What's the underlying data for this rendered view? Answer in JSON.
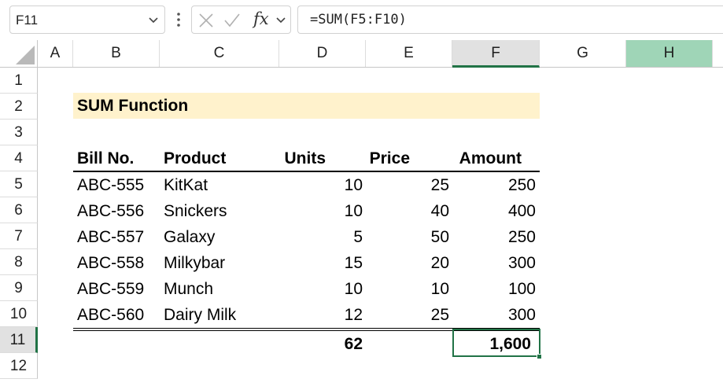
{
  "formula_bar": {
    "name_box": "F11",
    "formula": "=SUM(F5:F10)",
    "fx_label": "fx",
    "icons": [
      "chevron-down-icon",
      "more-vertical-icon",
      "cancel-x-icon",
      "enter-check-icon",
      "insert-function-icon"
    ]
  },
  "columns": [
    "A",
    "B",
    "C",
    "D",
    "E",
    "F",
    "G",
    "H"
  ],
  "rows": [
    "1",
    "2",
    "3",
    "4",
    "5",
    "6",
    "7",
    "8",
    "9",
    "10",
    "11",
    "12"
  ],
  "selection": {
    "active_column": "F",
    "active_row": "11",
    "highlight_column": "H"
  },
  "sheet": {
    "title": "SUM Function",
    "headers": {
      "bill": "Bill No.",
      "product": "Product",
      "units": "Units",
      "price": "Price",
      "amount": "Amount"
    },
    "records": [
      {
        "bill": "ABC-555",
        "product": "KitKat",
        "units": "10",
        "price": "25",
        "amount": "250"
      },
      {
        "bill": "ABC-556",
        "product": "Snickers",
        "units": "10",
        "price": "40",
        "amount": "400"
      },
      {
        "bill": "ABC-557",
        "product": "Galaxy",
        "units": "5",
        "price": "50",
        "amount": "250"
      },
      {
        "bill": "ABC-558",
        "product": "Milkybar",
        "units": "15",
        "price": "20",
        "amount": "300"
      },
      {
        "bill": "ABC-559",
        "product": "Munch",
        "units": "10",
        "price": "10",
        "amount": "100"
      },
      {
        "bill": "ABC-560",
        "product": "Dairy Milk",
        "units": "12",
        "price": "25",
        "amount": "300"
      }
    ],
    "totals": {
      "units": "62",
      "amount": "1,600"
    }
  },
  "colors": {
    "accent": "#217346",
    "title_fill": "#fff2cc",
    "highlight_header": "#9fd5b7"
  }
}
